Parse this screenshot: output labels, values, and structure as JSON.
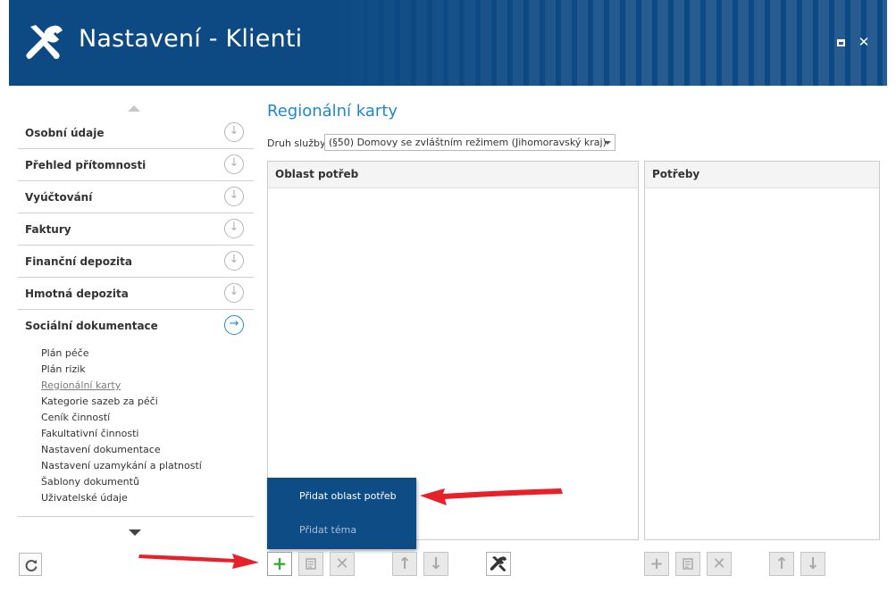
{
  "window": {
    "title": "Nastavení - Klienti",
    "maximize_icon": "maximize-icon",
    "close_icon": "close-icon",
    "close_glyph": "✕",
    "header_color": "#0d4a84"
  },
  "sidebar": {
    "items": [
      {
        "label": "Osobní údaje",
        "icon": "arrow-down-circle-icon",
        "state": "collapsed"
      },
      {
        "label": "Přehled přítomnosti",
        "icon": "arrow-down-circle-icon",
        "state": "collapsed"
      },
      {
        "label": "Vyúčtování",
        "icon": "arrow-down-circle-icon",
        "state": "collapsed"
      },
      {
        "label": "Faktury",
        "icon": "arrow-down-circle-icon",
        "state": "collapsed"
      },
      {
        "label": "Finanční depozita",
        "icon": "arrow-down-circle-icon",
        "state": "collapsed"
      },
      {
        "label": "Hmotná depozita",
        "icon": "arrow-down-circle-icon",
        "state": "collapsed"
      },
      {
        "label": "Sociální dokumentace",
        "icon": "arrow-right-circle-icon",
        "state": "expanded"
      }
    ],
    "sub_items": [
      "Plán péče",
      "Plán rizik",
      "Regionální karty",
      "Kategorie sazeb za péči",
      "Ceník činností",
      "Fakultativní činnosti",
      "Nastavení dokumentace",
      "Nastavení uzamykání a platností",
      "Šablony dokumentů",
      "Uživatelské údaje"
    ],
    "selected_sub_item": "Regionální karty",
    "accent_color": "#1e8bd0"
  },
  "main": {
    "title": "Regionální karty",
    "druh_label": "Druh služby:",
    "druh_value": "(§50) Domovy se zvláštním režimem (Jihomoravský kraj)",
    "left_panel_header": "Oblast potřeb",
    "right_panel_header": "Potřeby",
    "title_color": "#1e88c9"
  },
  "popup_menu": {
    "items": [
      "Přidat oblast potřeb",
      "Přidat téma"
    ],
    "background": "#0e4c86"
  },
  "toolbar_left": [
    "add-icon",
    "edit-icon",
    "delete-icon",
    "move-up-icon",
    "move-down-icon",
    "settings-icon"
  ],
  "toolbar_right": [
    "add-icon",
    "edit-icon",
    "delete-icon",
    "move-up-icon",
    "move-down-icon"
  ],
  "refresh_icon": "refresh-icon",
  "annotation_color": "#e8202a"
}
